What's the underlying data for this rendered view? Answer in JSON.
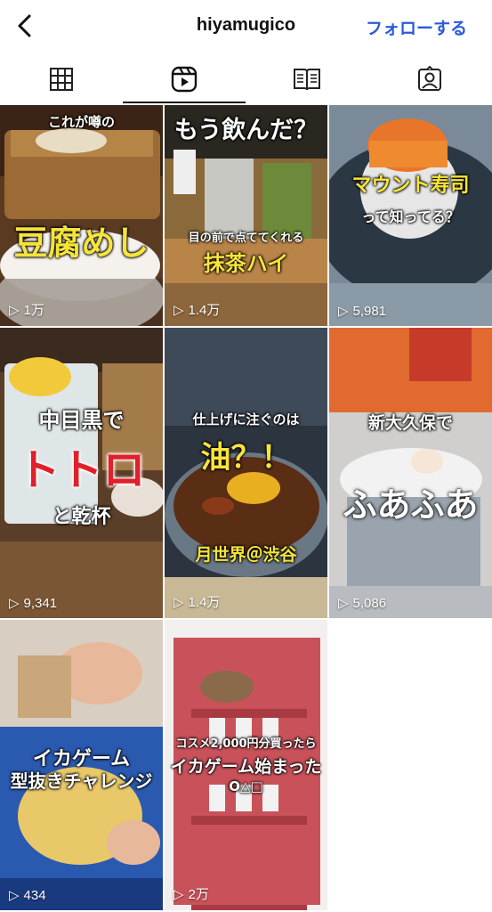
{
  "header": {
    "username": "hiyamugico",
    "follow_label": "フォローする"
  },
  "tabs": [
    {
      "icon": "grid-icon",
      "active": false
    },
    {
      "icon": "reels-icon",
      "active": true
    },
    {
      "icon": "guide-icon",
      "active": false
    },
    {
      "icon": "tagged-icon",
      "active": false
    }
  ],
  "videos": [
    {
      "caption_top": "これが噂の",
      "caption_main": "豆腐めし",
      "views": "1万"
    },
    {
      "caption_top": "もう飲んだ？",
      "caption_sub": "目の前で点ててくれる",
      "caption_main": "抹茶ハイ",
      "views": "1.4万"
    },
    {
      "caption_top": "マウント寿司",
      "caption_sub": "って知ってる？",
      "views": "5,981"
    },
    {
      "caption_top": "中目黒で",
      "caption_main": "トトロ",
      "caption_sub": "と乾杯",
      "views": "9,341"
    },
    {
      "caption_top": "仕上げに注ぐのは",
      "caption_main": "油？！",
      "caption_sub": "月世界＠渋谷",
      "views": "1.4万"
    },
    {
      "caption_top": "新大久保で",
      "caption_main": "ふあふあ",
      "views": "5,086"
    },
    {
      "caption_top": "イカゲーム",
      "caption_main": "型抜きチャレンジ",
      "views": "434"
    },
    {
      "caption_top": "コスメ2,000円分買ったら",
      "caption_main": "イカゲーム始まった",
      "caption_sub": "O△□",
      "views": "2万"
    }
  ]
}
